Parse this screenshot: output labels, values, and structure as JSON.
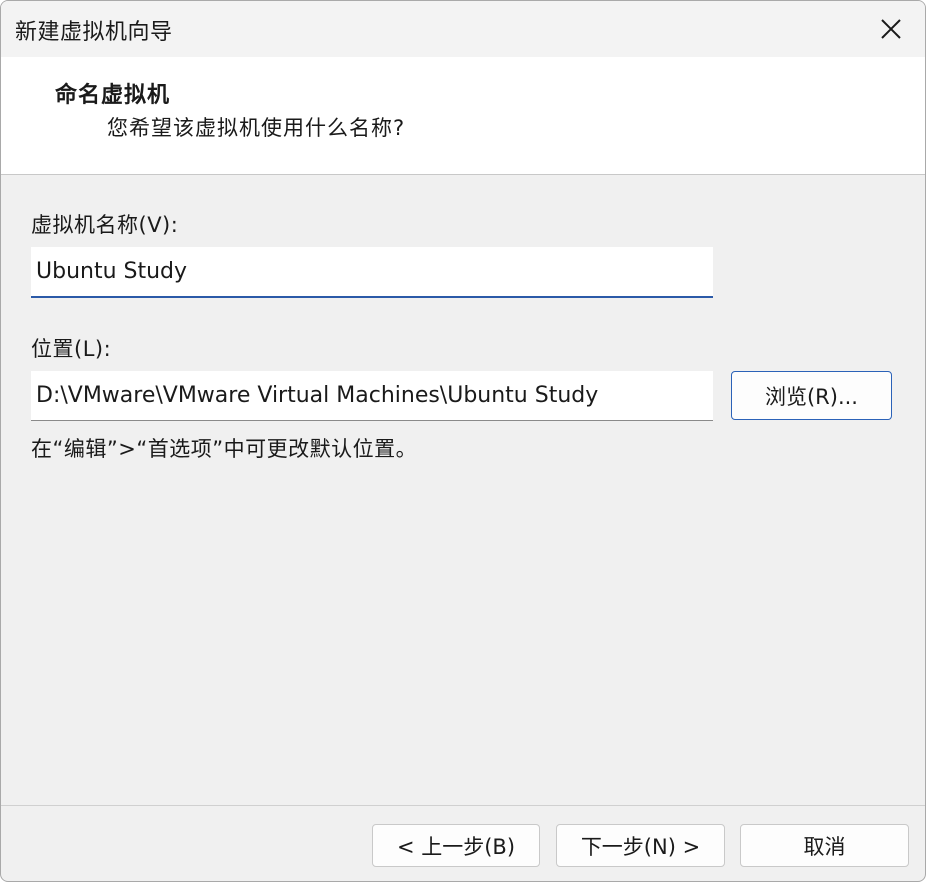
{
  "window": {
    "title": "新建虚拟机向导",
    "close_icon": "close-icon"
  },
  "header": {
    "title": "命名虚拟机",
    "subtitle": "您希望该虚拟机使用什么名称?"
  },
  "form": {
    "name_label": "虚拟机名称(V):",
    "name_value": "Ubuntu Study",
    "location_label": "位置(L):",
    "location_value": "D:\\VMware\\VMware Virtual Machines\\Ubuntu Study",
    "browse_label": "浏览(R)...",
    "hint": "在“编辑”>“首选项”中可更改默认位置。"
  },
  "footer": {
    "back_label": "< 上一步(B)",
    "next_label": "下一步(N) >",
    "cancel_label": "取消"
  },
  "colors": {
    "accent": "#2b5aa8",
    "background": "#f0f0f0",
    "header_background": "#ffffff"
  }
}
